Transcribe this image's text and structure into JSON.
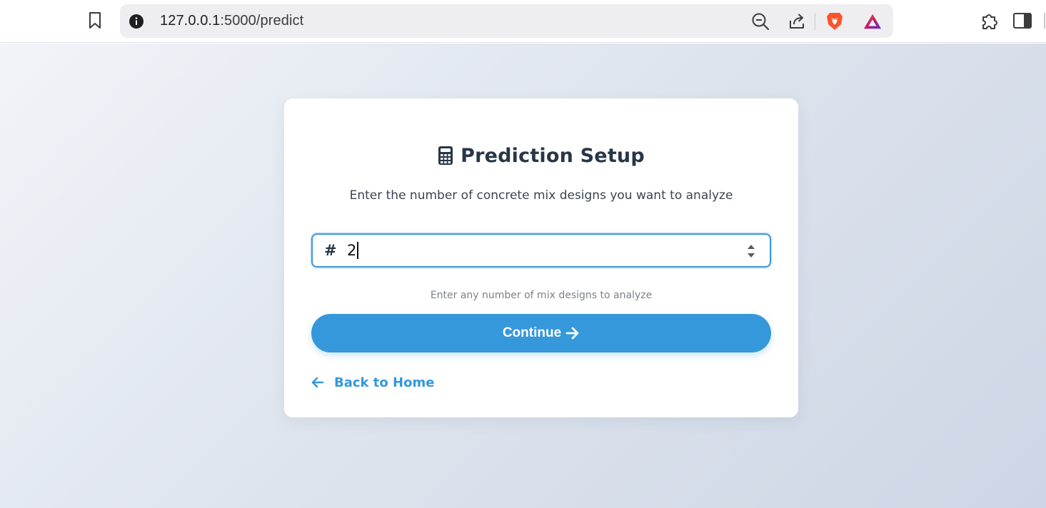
{
  "browser": {
    "url_host": "127.0.0.1",
    "url_path": ":5000/predict",
    "icons": {
      "bookmark": "bookmark-icon",
      "site_info": "info-icon",
      "zoom": "zoom-out-icon",
      "share": "share-icon",
      "brave": "brave-shields-icon",
      "rewards": "brave-rewards-icon",
      "extensions": "puzzle-icon",
      "sidebar": "sidebar-icon"
    }
  },
  "page": {
    "title": "Prediction Setup",
    "title_icon": "calculator-icon",
    "subtitle": "Enter the number of concrete mix designs you want to analyze",
    "input": {
      "prefix_icon": "#",
      "value": "2"
    },
    "hint": "Enter any number of mix designs to analyze",
    "continue_label": "Continue",
    "back_label": "Back to Home"
  },
  "colors": {
    "accent": "#3498db",
    "title_text": "#283747",
    "brave_orange": "#fb542b"
  }
}
